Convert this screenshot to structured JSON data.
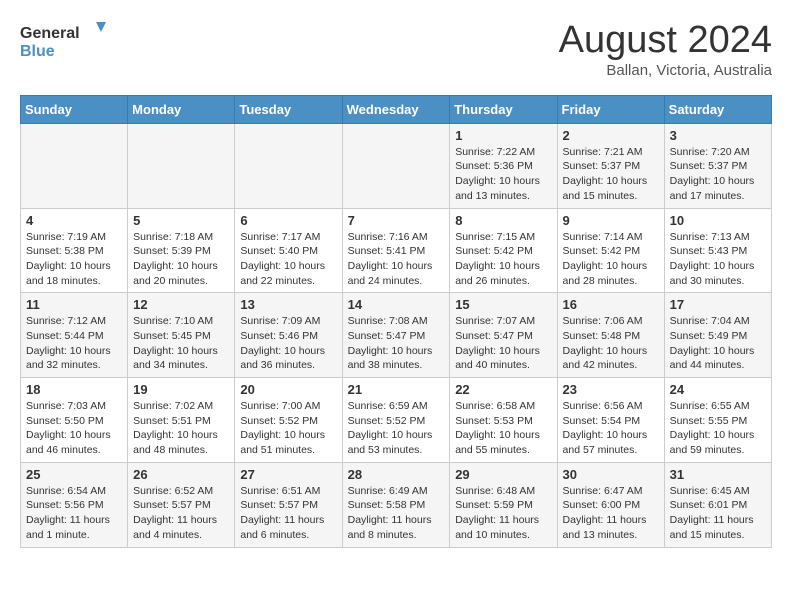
{
  "header": {
    "logo_line1": "General",
    "logo_line2": "Blue",
    "month": "August 2024",
    "location": "Ballan, Victoria, Australia"
  },
  "days_of_week": [
    "Sunday",
    "Monday",
    "Tuesday",
    "Wednesday",
    "Thursday",
    "Friday",
    "Saturday"
  ],
  "weeks": [
    [
      {
        "day": "",
        "info": ""
      },
      {
        "day": "",
        "info": ""
      },
      {
        "day": "",
        "info": ""
      },
      {
        "day": "",
        "info": ""
      },
      {
        "day": "1",
        "info": "Sunrise: 7:22 AM\nSunset: 5:36 PM\nDaylight: 10 hours\nand 13 minutes."
      },
      {
        "day": "2",
        "info": "Sunrise: 7:21 AM\nSunset: 5:37 PM\nDaylight: 10 hours\nand 15 minutes."
      },
      {
        "day": "3",
        "info": "Sunrise: 7:20 AM\nSunset: 5:37 PM\nDaylight: 10 hours\nand 17 minutes."
      }
    ],
    [
      {
        "day": "4",
        "info": "Sunrise: 7:19 AM\nSunset: 5:38 PM\nDaylight: 10 hours\nand 18 minutes."
      },
      {
        "day": "5",
        "info": "Sunrise: 7:18 AM\nSunset: 5:39 PM\nDaylight: 10 hours\nand 20 minutes."
      },
      {
        "day": "6",
        "info": "Sunrise: 7:17 AM\nSunset: 5:40 PM\nDaylight: 10 hours\nand 22 minutes."
      },
      {
        "day": "7",
        "info": "Sunrise: 7:16 AM\nSunset: 5:41 PM\nDaylight: 10 hours\nand 24 minutes."
      },
      {
        "day": "8",
        "info": "Sunrise: 7:15 AM\nSunset: 5:42 PM\nDaylight: 10 hours\nand 26 minutes."
      },
      {
        "day": "9",
        "info": "Sunrise: 7:14 AM\nSunset: 5:42 PM\nDaylight: 10 hours\nand 28 minutes."
      },
      {
        "day": "10",
        "info": "Sunrise: 7:13 AM\nSunset: 5:43 PM\nDaylight: 10 hours\nand 30 minutes."
      }
    ],
    [
      {
        "day": "11",
        "info": "Sunrise: 7:12 AM\nSunset: 5:44 PM\nDaylight: 10 hours\nand 32 minutes."
      },
      {
        "day": "12",
        "info": "Sunrise: 7:10 AM\nSunset: 5:45 PM\nDaylight: 10 hours\nand 34 minutes."
      },
      {
        "day": "13",
        "info": "Sunrise: 7:09 AM\nSunset: 5:46 PM\nDaylight: 10 hours\nand 36 minutes."
      },
      {
        "day": "14",
        "info": "Sunrise: 7:08 AM\nSunset: 5:47 PM\nDaylight: 10 hours\nand 38 minutes."
      },
      {
        "day": "15",
        "info": "Sunrise: 7:07 AM\nSunset: 5:47 PM\nDaylight: 10 hours\nand 40 minutes."
      },
      {
        "day": "16",
        "info": "Sunrise: 7:06 AM\nSunset: 5:48 PM\nDaylight: 10 hours\nand 42 minutes."
      },
      {
        "day": "17",
        "info": "Sunrise: 7:04 AM\nSunset: 5:49 PM\nDaylight: 10 hours\nand 44 minutes."
      }
    ],
    [
      {
        "day": "18",
        "info": "Sunrise: 7:03 AM\nSunset: 5:50 PM\nDaylight: 10 hours\nand 46 minutes."
      },
      {
        "day": "19",
        "info": "Sunrise: 7:02 AM\nSunset: 5:51 PM\nDaylight: 10 hours\nand 48 minutes."
      },
      {
        "day": "20",
        "info": "Sunrise: 7:00 AM\nSunset: 5:52 PM\nDaylight: 10 hours\nand 51 minutes."
      },
      {
        "day": "21",
        "info": "Sunrise: 6:59 AM\nSunset: 5:52 PM\nDaylight: 10 hours\nand 53 minutes."
      },
      {
        "day": "22",
        "info": "Sunrise: 6:58 AM\nSunset: 5:53 PM\nDaylight: 10 hours\nand 55 minutes."
      },
      {
        "day": "23",
        "info": "Sunrise: 6:56 AM\nSunset: 5:54 PM\nDaylight: 10 hours\nand 57 minutes."
      },
      {
        "day": "24",
        "info": "Sunrise: 6:55 AM\nSunset: 5:55 PM\nDaylight: 10 hours\nand 59 minutes."
      }
    ],
    [
      {
        "day": "25",
        "info": "Sunrise: 6:54 AM\nSunset: 5:56 PM\nDaylight: 11 hours\nand 1 minute."
      },
      {
        "day": "26",
        "info": "Sunrise: 6:52 AM\nSunset: 5:57 PM\nDaylight: 11 hours\nand 4 minutes."
      },
      {
        "day": "27",
        "info": "Sunrise: 6:51 AM\nSunset: 5:57 PM\nDaylight: 11 hours\nand 6 minutes."
      },
      {
        "day": "28",
        "info": "Sunrise: 6:49 AM\nSunset: 5:58 PM\nDaylight: 11 hours\nand 8 minutes."
      },
      {
        "day": "29",
        "info": "Sunrise: 6:48 AM\nSunset: 5:59 PM\nDaylight: 11 hours\nand 10 minutes."
      },
      {
        "day": "30",
        "info": "Sunrise: 6:47 AM\nSunset: 6:00 PM\nDaylight: 11 hours\nand 13 minutes."
      },
      {
        "day": "31",
        "info": "Sunrise: 6:45 AM\nSunset: 6:01 PM\nDaylight: 11 hours\nand 15 minutes."
      }
    ]
  ]
}
